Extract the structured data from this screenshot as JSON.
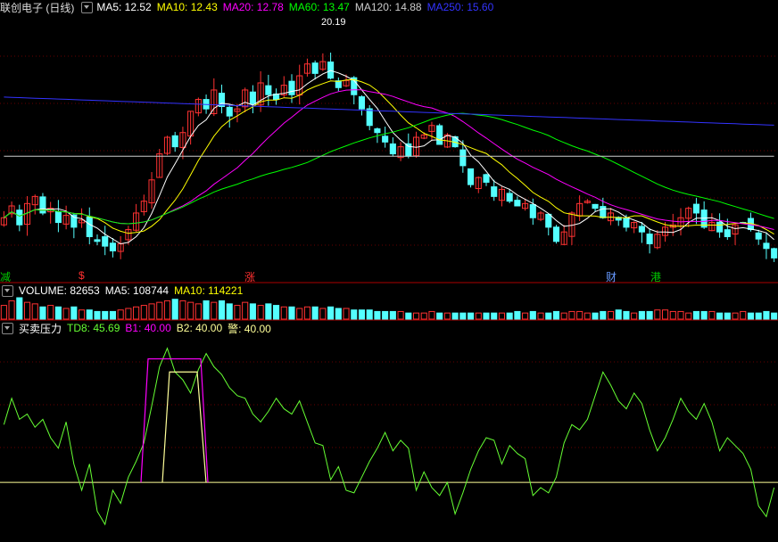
{
  "header": {
    "title": "联创电子 (日线)",
    "ma_labels": [
      {
        "text": "MA5: 12.52",
        "color": "#ffffff"
      },
      {
        "text": "MA10: 12.43",
        "color": "#ffff00"
      },
      {
        "text": "MA20: 12.78",
        "color": "#ff00ff"
      },
      {
        "text": "MA60: 13.47",
        "color": "#00ff00"
      },
      {
        "text": "MA120: 14.88",
        "color": "#cccccc"
      },
      {
        "text": "MA250: 15.60",
        "color": "#3333ff"
      }
    ],
    "high_label": "20.19"
  },
  "event_tags": [
    {
      "text": "减",
      "color": "#00cc00"
    },
    {
      "text": "$",
      "color": "#ff3030"
    },
    {
      "text": "涨",
      "color": "#ff3030"
    },
    {
      "text": "财",
      "color": "#6699ff"
    },
    {
      "text": "港",
      "color": "#00cc00"
    }
  ],
  "volume_header": {
    "title": "VOLUME: 82653",
    "ma5": "MA5: 108744",
    "ma10": "MA10: 114221"
  },
  "indicator_header": {
    "title": "买卖压力",
    "td8": "TD8: 45.69",
    "b1": "B1: 40.00",
    "b2": "B2: 40.00",
    "warn": "警: 40.00"
  },
  "colors": {
    "up": "#ff3232",
    "down": "#54ffff",
    "ma5": "#ffffff",
    "ma10": "#ffff00",
    "ma20": "#ff00ff",
    "ma60": "#00ff00",
    "ma120": "#cccccc",
    "ma250": "#3333ff",
    "td8": "#66ff33",
    "b1": "#ff00ff",
    "b2": "#ffff99",
    "warn": "#ffff99"
  },
  "chart_data": {
    "type": "candlestick",
    "price_closes": [
      12.4,
      12.9,
      12.1,
      13.0,
      13.3,
      12.6,
      12.8,
      12.2,
      12.5,
      12.0,
      12.3,
      11.6,
      11.4,
      11.2,
      11.0,
      11.3,
      11.9,
      12.6,
      13.1,
      14.0,
      15.1,
      15.8,
      15.4,
      16.0,
      16.9,
      17.4,
      17.0,
      17.8,
      17.1,
      16.7,
      17.0,
      17.8,
      17.2,
      18.1,
      17.6,
      17.4,
      18.0,
      17.6,
      18.4,
      18.9,
      18.5,
      19.0,
      18.3,
      17.9,
      18.2,
      17.6,
      17.0,
      16.3,
      16.0,
      15.6,
      15.1,
      15.4,
      15.0,
      15.8,
      15.9,
      16.3,
      15.5,
      15.9,
      15.4,
      14.6,
      13.8,
      14.1,
      13.9,
      13.3,
      13.6,
      13.1,
      12.9,
      13.0,
      12.4,
      12.6,
      12.0,
      11.4,
      11.8,
      12.6,
      13.0,
      13.1,
      12.8,
      12.4,
      12.6,
      12.3,
      12.0,
      12.2,
      11.8,
      11.3,
      11.7,
      12.0,
      12.1,
      12.4,
      12.8,
      12.6,
      12.0,
      12.2,
      11.8,
      11.6,
      12.1,
      12.2,
      11.9,
      11.5,
      11.1,
      10.7
    ],
    "price_ylim": [
      10.3,
      21.0
    ],
    "volume_values": [
      9,
      12,
      14,
      11,
      10,
      8,
      9,
      8,
      7,
      8,
      6,
      6,
      5,
      5,
      5,
      6,
      7,
      8,
      9,
      10,
      11,
      12,
      13,
      12,
      11,
      10,
      12,
      11,
      12,
      10,
      9,
      11,
      10,
      9,
      10,
      9,
      8,
      8,
      7,
      8,
      8,
      7,
      8,
      7,
      7,
      6,
      6,
      6,
      5,
      5,
      5,
      5,
      4,
      4,
      4,
      5,
      4,
      4,
      4,
      4,
      4,
      4,
      4,
      4,
      4,
      4,
      5,
      4,
      5,
      4,
      4,
      5,
      4,
      5,
      5,
      4,
      4,
      5,
      5,
      6,
      5,
      4,
      5,
      5,
      6,
      6,
      5,
      5,
      4,
      5,
      5,
      5,
      4,
      4,
      4,
      5,
      4,
      4,
      5,
      4
    ],
    "td8_values": [
      62,
      72,
      64,
      66,
      61,
      64,
      57,
      53,
      63,
      47,
      37,
      47,
      29,
      24,
      37,
      32,
      42,
      48,
      55,
      69,
      84,
      91,
      82,
      79,
      74,
      83,
      89,
      84,
      81,
      76,
      73,
      72,
      66,
      63,
      67,
      72,
      68,
      66,
      71,
      63,
      55,
      54,
      41,
      46,
      37,
      36,
      42,
      48,
      53,
      59,
      52,
      56,
      53,
      37,
      44,
      38,
      35,
      40,
      28,
      36,
      45,
      52,
      57,
      56,
      47,
      54,
      51,
      49,
      35,
      38,
      36,
      42,
      55,
      62,
      60,
      64,
      73,
      82,
      77,
      71,
      68,
      74,
      70,
      60,
      52,
      57,
      64,
      72,
      67,
      64,
      70,
      63,
      52,
      57,
      54,
      51,
      45,
      31,
      27,
      38
    ],
    "b1_range": [
      36,
      87
    ],
    "b2_range": [
      36,
      82
    ],
    "indicator_levels": {
      "b1": 40.0,
      "b2": 40.0,
      "warn": 40.0
    },
    "td8_last": 45.69
  }
}
